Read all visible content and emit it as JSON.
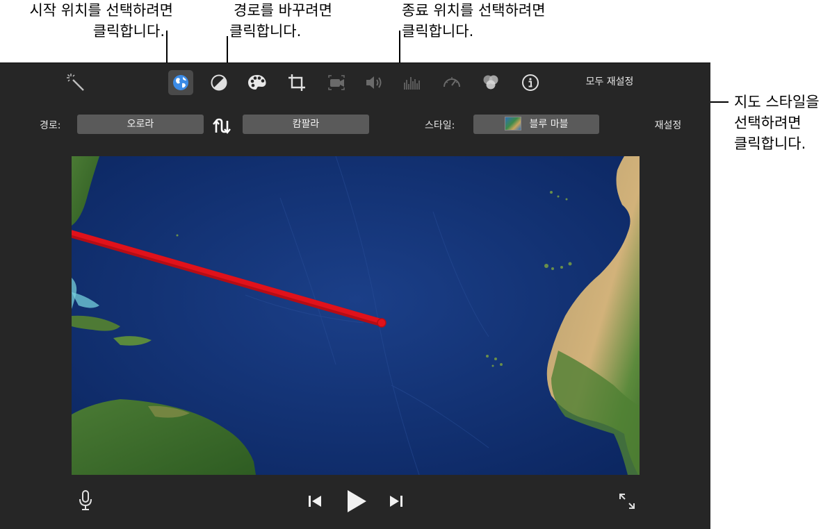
{
  "callouts": {
    "start": [
      "시작 위치를 선택하려면",
      "클릭합니다."
    ],
    "route": [
      "경로를 바꾸려면",
      "클릭합니다."
    ],
    "end": [
      "종료 위치를 선택하려면",
      "클릭합니다."
    ],
    "map_style": [
      "지도 스타일을",
      "선택하려면",
      "클릭합니다."
    ]
  },
  "toolbar": {
    "icons": [
      "magic-wand-icon",
      "globe-icon",
      "color-balance-icon",
      "palette-icon",
      "crop-icon",
      "stabilization-icon",
      "volume-icon",
      "equalizer-icon",
      "speed-icon",
      "filters-icon",
      "info-icon"
    ],
    "active_icon": "globe-icon",
    "reset_all_label": "모두 재설정"
  },
  "route": {
    "label": "경로:",
    "start_location": "오로라",
    "end_location": "캄팔라"
  },
  "style": {
    "label": "스타일:",
    "value": "블루 마블",
    "reset_label": "재설정"
  },
  "colors": {
    "panel_bg": "#262626",
    "field_bg": "#5a5a5a",
    "route_line": "#e0121b",
    "ocean": "#0e2f70"
  },
  "playback": {
    "icons": [
      "microphone-icon",
      "previous-icon",
      "play-icon",
      "next-icon",
      "fullscreen-icon"
    ]
  }
}
